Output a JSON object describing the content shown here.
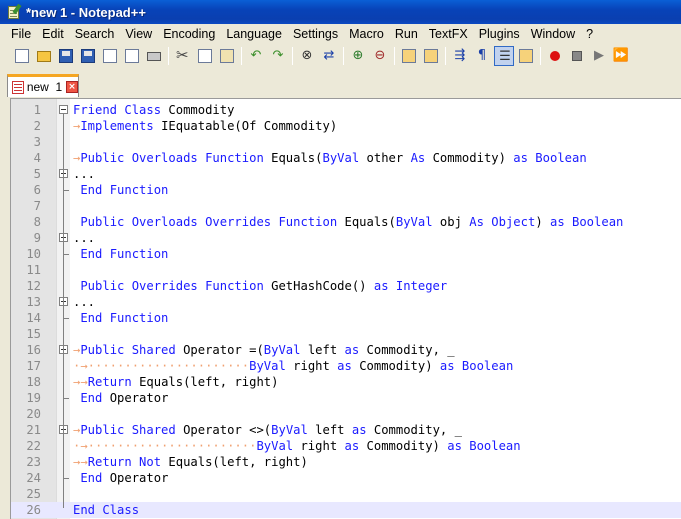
{
  "window": {
    "title": "*new  1 - Notepad++"
  },
  "menu": [
    "File",
    "Edit",
    "Search",
    "View",
    "Encoding",
    "Language",
    "Settings",
    "Macro",
    "Run",
    "TextFX",
    "Plugins",
    "Window",
    "?"
  ],
  "toolbar": {
    "buttons": [
      "new-file",
      "open-file",
      "save",
      "save-all",
      "close",
      "close-all",
      "print",
      "cut",
      "copy",
      "paste",
      "undo",
      "redo",
      "find",
      "replace",
      "zoom-in",
      "zoom-out",
      "sync-vertical",
      "sync-horizontal",
      "word-wrap",
      "show-all-chars",
      "indent-guide",
      "user-define",
      "record-macro",
      "stop-record",
      "play-macro",
      "run-macro-multiple"
    ]
  },
  "tabs": [
    {
      "label": "new  1",
      "active": true
    }
  ],
  "editor": {
    "current_line": 26,
    "lines": [
      [
        [
          "kw",
          "Friend Class "
        ],
        [
          "tx",
          "Commodity"
        ]
      ],
      [
        [
          "ar",
          "→"
        ],
        [
          "kw",
          "Implements "
        ],
        [
          "tx",
          "IEquatable(Of Commodity)"
        ]
      ],
      [],
      [
        [
          "ar",
          "→"
        ],
        [
          "kw",
          "Public Overloads Function "
        ],
        [
          "tx",
          "Equals("
        ],
        [
          "kw",
          "ByVal "
        ],
        [
          "tx",
          "other "
        ],
        [
          "kw",
          "As "
        ],
        [
          "tx",
          "Commodity) "
        ],
        [
          "kw",
          "as Boolean"
        ]
      ],
      [
        [
          "tx",
          "..."
        ]
      ],
      [
        [
          "tx",
          " "
        ],
        [
          "kw",
          "End Function"
        ]
      ],
      [],
      [
        [
          "tx",
          " "
        ],
        [
          "kw",
          "Public Overloads Overrides Function "
        ],
        [
          "tx",
          "Equals("
        ],
        [
          "kw",
          "ByVal "
        ],
        [
          "tx",
          "obj "
        ],
        [
          "kw",
          "As Object"
        ],
        [
          "tx",
          ") "
        ],
        [
          "kw",
          "as Boolean"
        ]
      ],
      [
        [
          "tx",
          "..."
        ]
      ],
      [
        [
          "tx",
          " "
        ],
        [
          "kw",
          "End Function"
        ]
      ],
      [],
      [
        [
          "tx",
          " "
        ],
        [
          "kw",
          "Public Overrides Function "
        ],
        [
          "tx",
          "GetHashCode() "
        ],
        [
          "kw",
          "as Integer"
        ]
      ],
      [
        [
          "tx",
          "..."
        ]
      ],
      [
        [
          "tx",
          " "
        ],
        [
          "kw",
          "End Function"
        ]
      ],
      [],
      [
        [
          "ar",
          "→"
        ],
        [
          "kw",
          "Public Shared "
        ],
        [
          "tx",
          "Operator =("
        ],
        [
          "kw",
          "ByVal "
        ],
        [
          "tx",
          "left "
        ],
        [
          "kw",
          "as "
        ],
        [
          "tx",
          "Commodity, _"
        ]
      ],
      [
        [
          "ar",
          "·→······················"
        ],
        [
          "kw",
          "ByVal "
        ],
        [
          "tx",
          "right "
        ],
        [
          "kw",
          "as "
        ],
        [
          "tx",
          "Commodity) "
        ],
        [
          "kw",
          "as Boolean"
        ]
      ],
      [
        [
          "ar",
          "→→"
        ],
        [
          "kw",
          "Return "
        ],
        [
          "tx",
          "Equals(left, right)"
        ]
      ],
      [
        [
          "tx",
          " "
        ],
        [
          "kw",
          "End "
        ],
        [
          "tx",
          "Operator"
        ]
      ],
      [],
      [
        [
          "ar",
          "→"
        ],
        [
          "kw",
          "Public Shared "
        ],
        [
          "tx",
          "Operator <>("
        ],
        [
          "kw",
          "ByVal "
        ],
        [
          "tx",
          "left "
        ],
        [
          "kw",
          "as "
        ],
        [
          "tx",
          "Commodity, _"
        ]
      ],
      [
        [
          "ar",
          "·→·······················"
        ],
        [
          "kw",
          "ByVal "
        ],
        [
          "tx",
          "right "
        ],
        [
          "kw",
          "as "
        ],
        [
          "tx",
          "Commodity) "
        ],
        [
          "kw",
          "as Boolean"
        ]
      ],
      [
        [
          "ar",
          "→→"
        ],
        [
          "kw",
          "Return Not "
        ],
        [
          "tx",
          "Equals(left, right)"
        ]
      ],
      [
        [
          "tx",
          " "
        ],
        [
          "kw",
          "End "
        ],
        [
          "tx",
          "Operator"
        ]
      ],
      [],
      [
        [
          "kw",
          "End Class"
        ]
      ]
    ]
  }
}
